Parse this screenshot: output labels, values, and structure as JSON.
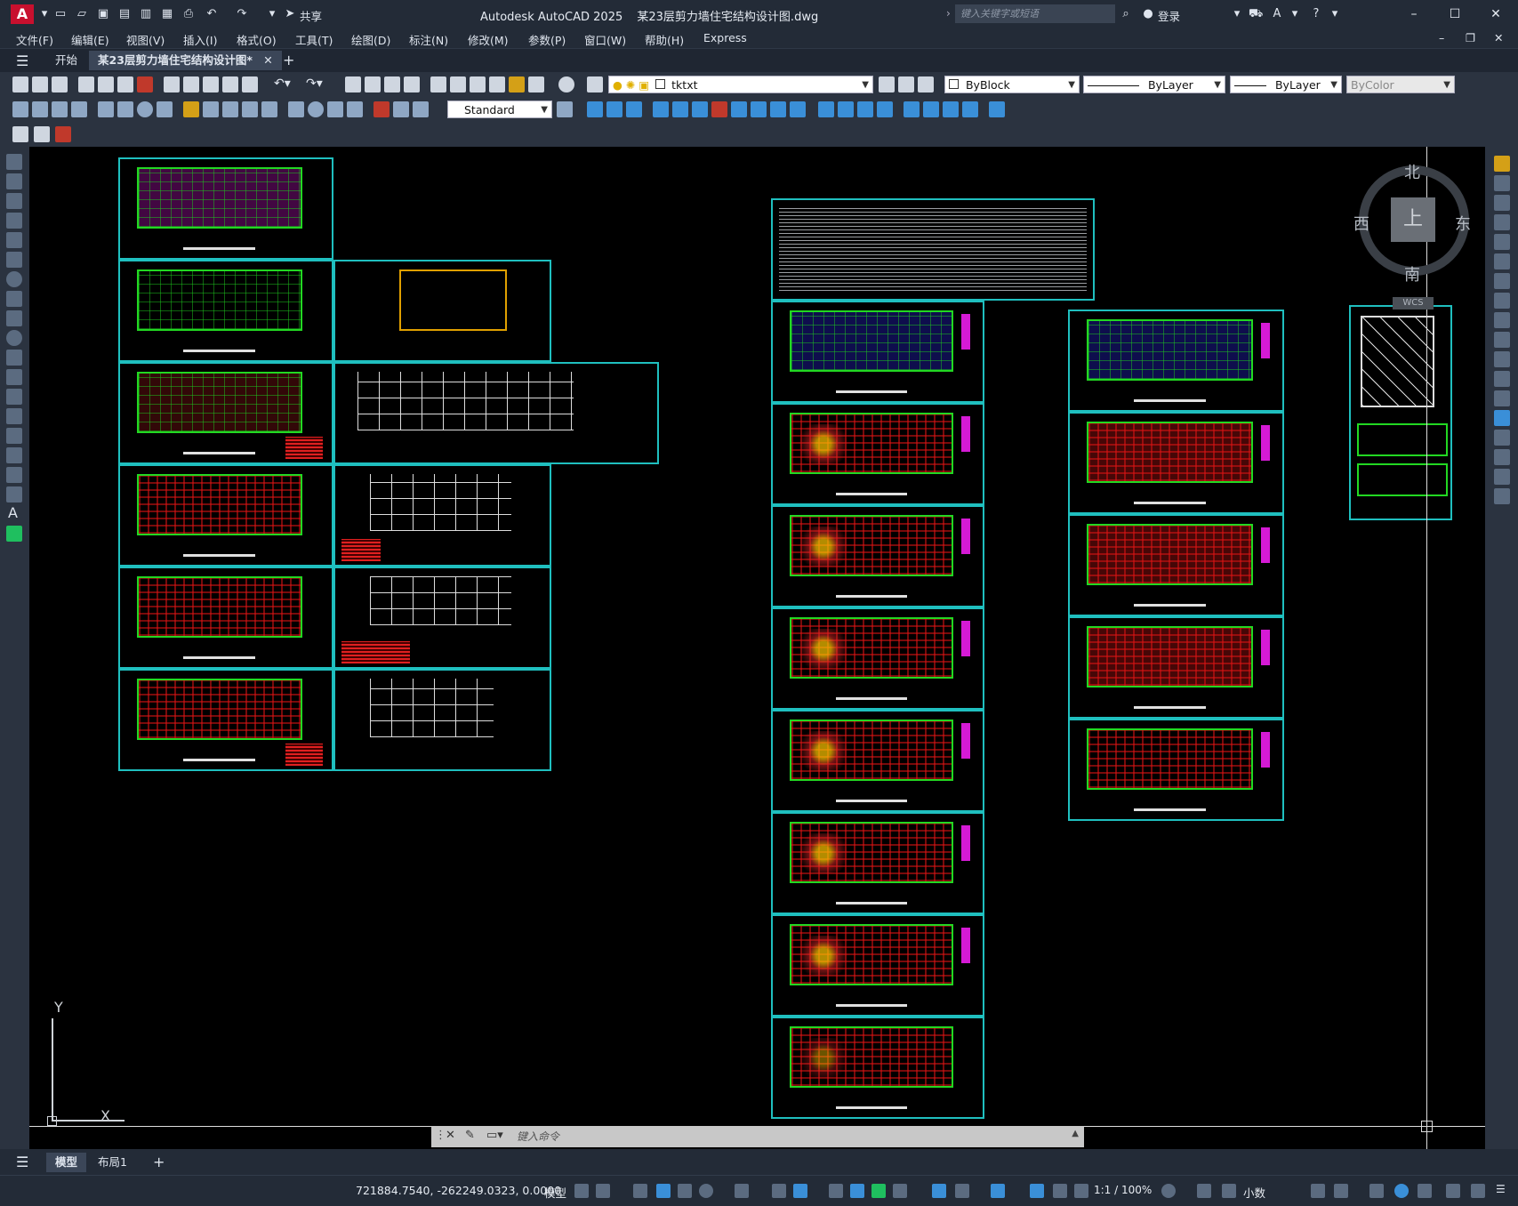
{
  "app": {
    "logo": "A",
    "title": "Autodesk AutoCAD 2025",
    "document_title": "某23层剪力墙住宅结构设计图.dwg",
    "share_label": "共享",
    "search_placeholder": "键入关键字或短语",
    "login_label": "登录"
  },
  "menu": [
    "文件(F)",
    "编辑(E)",
    "视图(V)",
    "插入(I)",
    "格式(O)",
    "工具(T)",
    "绘图(D)",
    "标注(N)",
    "修改(M)",
    "参数(P)",
    "窗口(W)",
    "帮助(H)",
    "Express"
  ],
  "tabs": {
    "start": "开始",
    "active_doc": "某23层剪力墙住宅结构设计图*",
    "new_tab": "+"
  },
  "properties": {
    "layer": "tktxt",
    "color": "ByBlock",
    "linetype": "ByLayer",
    "lineweight": "ByLayer",
    "plotstyle": "ByColor",
    "text_style": "Standard"
  },
  "viewcube": {
    "north": "北",
    "south": "南",
    "east": "东",
    "west": "西",
    "top": "上",
    "ucs": "WCS"
  },
  "ucs_icon": {
    "x": "X",
    "y": "Y"
  },
  "command": {
    "placeholder": "键入命令"
  },
  "layout_tabs": [
    "模型",
    "布局1"
  ],
  "status": {
    "coordinates": "721884.7540, -262249.0323, 0.0000",
    "model_label": "模型",
    "scale": "1:1 / 100%",
    "units": "小数"
  },
  "colors": {
    "accent": "#1fbfbf",
    "drawing_bg": "#000000",
    "ui_dark": "#232b37",
    "plan_green": "#22d822",
    "plan_red": "#dc1414",
    "magenta": "#d51ad5"
  }
}
